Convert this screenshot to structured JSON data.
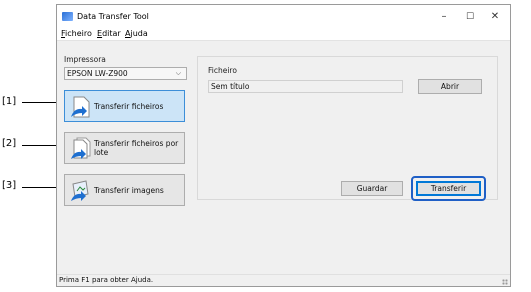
{
  "callouts": [
    "[1]",
    "[2]",
    "[3]"
  ],
  "window": {
    "title": "Data Transfer Tool",
    "controls": {
      "minimize": "–",
      "maximize": "☐",
      "close": "✕"
    }
  },
  "menu": [
    "Ficheiro",
    "Editar",
    "Ajuda"
  ],
  "printer": {
    "label": "Impressora",
    "selected": "EPSON LW-Z900"
  },
  "sidebar": {
    "buttons": [
      {
        "label": "Transferir ficheiros",
        "selected": true,
        "icon": "file-transfer-icon"
      },
      {
        "label": "Transferir ficheiros por lote",
        "selected": false,
        "icon": "batch-transfer-icon"
      },
      {
        "label": "Transferir imagens",
        "selected": false,
        "icon": "image-transfer-icon"
      }
    ]
  },
  "file_panel": {
    "label": "Ficheiro",
    "value": "Sem título",
    "open_button": "Abrir",
    "save_button": "Guardar",
    "transfer_button": "Transferir"
  },
  "status": "Prima F1 para obter Ajuda.",
  "colors": {
    "accent": "#0078d7",
    "selected_bg": "#cce4f7",
    "callout_ring": "#1f5fc6"
  }
}
